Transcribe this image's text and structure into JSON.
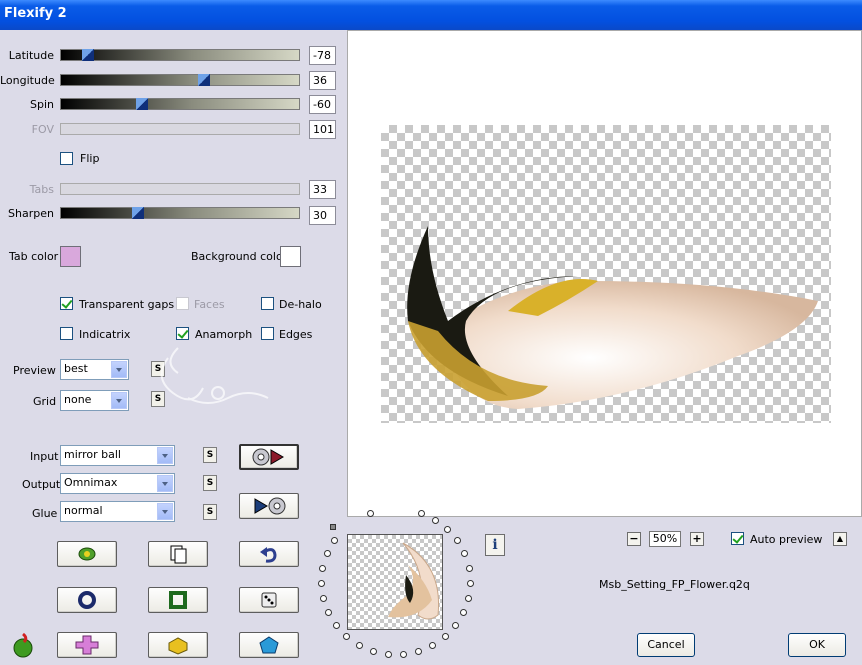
{
  "window": {
    "title": "Flexify 2"
  },
  "sliders": [
    {
      "id": "latitude",
      "label": "Latitude",
      "value": "-78",
      "fraction": 0.09,
      "enabled": true
    },
    {
      "id": "longitude",
      "label": "Longitude",
      "value": "36",
      "fraction": 0.6,
      "enabled": true
    },
    {
      "id": "spin",
      "label": "Spin",
      "value": "-60",
      "fraction": 0.33,
      "enabled": true
    },
    {
      "id": "fov",
      "label": "FOV",
      "value": "101",
      "enabled": false
    },
    {
      "id": "tabs",
      "label": "Tabs",
      "value": "33",
      "enabled": false
    },
    {
      "id": "sharpen",
      "label": "Sharpen",
      "value": "30",
      "fraction": 0.31,
      "enabled": true
    }
  ],
  "flip": {
    "label": "Flip",
    "checked": false
  },
  "colors": {
    "tab_label": "Tab color",
    "tab_value": "#d9a8dc",
    "background_label": "Background color",
    "background_value": "#ffffff"
  },
  "options": {
    "transparent_gaps": {
      "label": "Transparent gaps",
      "checked": true
    },
    "faces": {
      "label": "Faces",
      "checked": false,
      "enabled": false
    },
    "de_halo": {
      "label": "De-halo",
      "checked": false
    },
    "indicatrix": {
      "label": "Indicatrix",
      "checked": false
    },
    "anamorph": {
      "label": "Anamorph",
      "checked": true
    },
    "edges": {
      "label": "Edges",
      "checked": false
    }
  },
  "preview": {
    "label": "Preview",
    "value": "best"
  },
  "grid": {
    "label": "Grid",
    "value": "none"
  },
  "input": {
    "label": "Input",
    "value": "mirror ball"
  },
  "output": {
    "label": "Output",
    "value": "Omnimax"
  },
  "glue": {
    "label": "Glue",
    "value": "normal"
  },
  "s_button_label": "S",
  "zoom": {
    "value": "50%",
    "minus": "−",
    "plus": "+"
  },
  "auto_preview": {
    "label": "Auto preview",
    "checked": true
  },
  "up_button": "▲",
  "info_button": "i",
  "filename": "Msb_Setting_FP_Flower.q2q",
  "buttons": {
    "cancel": "Cancel",
    "ok": "OK"
  },
  "icons": {
    "render_to_output": "disc-arrow-icon",
    "output_to_input": "arrow-disc-icon",
    "randomize_leaf": "leaf-icon",
    "copy": "copy-pages-icon",
    "undo": "undo-arrow-icon",
    "ring": "ring-icon",
    "square": "square-frame-icon",
    "dice": "dice-icon",
    "logo": "flaming-pear-logo-icon",
    "cross": "pink-cross-icon",
    "cheese": "yellow-block-icon",
    "pentagon": "blue-pentagon-icon"
  },
  "accent_colors": {
    "title_bar": "#0350e0",
    "check_mark": "#21a121",
    "panel": "#dcdbe8"
  }
}
